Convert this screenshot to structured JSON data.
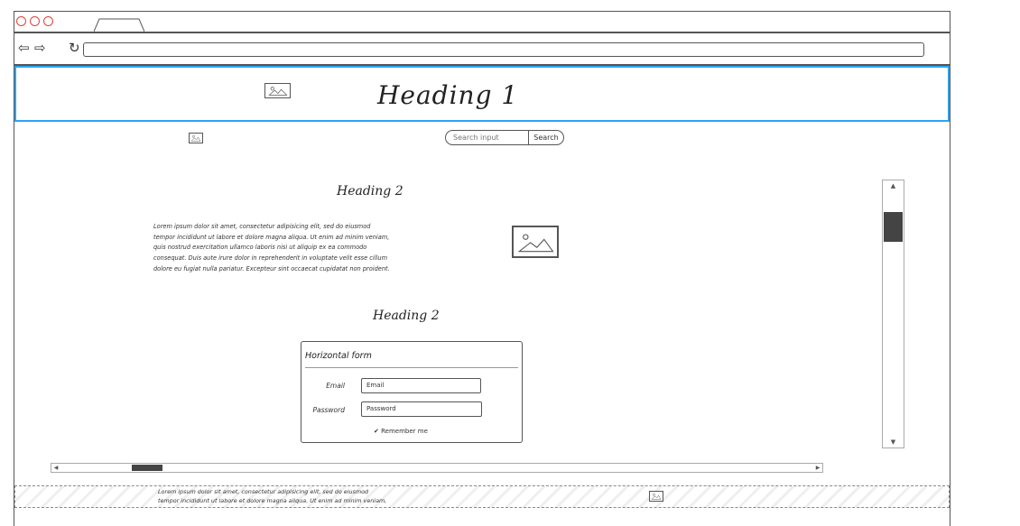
{
  "header": {
    "heading": "Heading 1"
  },
  "search": {
    "placeholder": "Search input",
    "button_label": "Search"
  },
  "main": {
    "section1_heading": "Heading 2",
    "paragraph_lines": [
      "Lorem ipsum dolor sit amet, consectetur adipisicing elit, sed do eiusmod",
      "tempor incididunt ut labore et dolore magna aliqua. Ut enim ad minim veniam,",
      "quis nostrud exercitation ullamco laboris nisi ut aliquip ex ea commodo",
      "consequat. Duis aute irure dolor in reprehenderit in voluptate velit esse cillum",
      "dolore eu fugiat nulla pariatur. Excepteur sint occaecat cupidatat non proident."
    ],
    "section2_heading": "Heading 2"
  },
  "form": {
    "title": "Horizontal form",
    "email_label": "Email",
    "email_placeholder": "Email",
    "password_label": "Password",
    "password_placeholder": "Password",
    "remember_label": "Remember me",
    "remember_checked": true
  },
  "footer": {
    "paragraph_lines": [
      "Lorem ipsum dolor sit amet, consectetur adipisicing elit, sed do eiusmod",
      "tempor incididunt ut labore et dolore magna aliqua. Ut enim ad minim veniam,"
    ]
  },
  "icons": {
    "back": "arrow-left-icon",
    "forward": "arrow-right-icon",
    "reload": "reload-icon",
    "image": "image-placeholder-icon",
    "checkbox": "checkbox-icon"
  },
  "colors": {
    "header_border": "#2ea3f2",
    "window_dots": "#e0443a",
    "scroll_thumb": "#444444"
  }
}
